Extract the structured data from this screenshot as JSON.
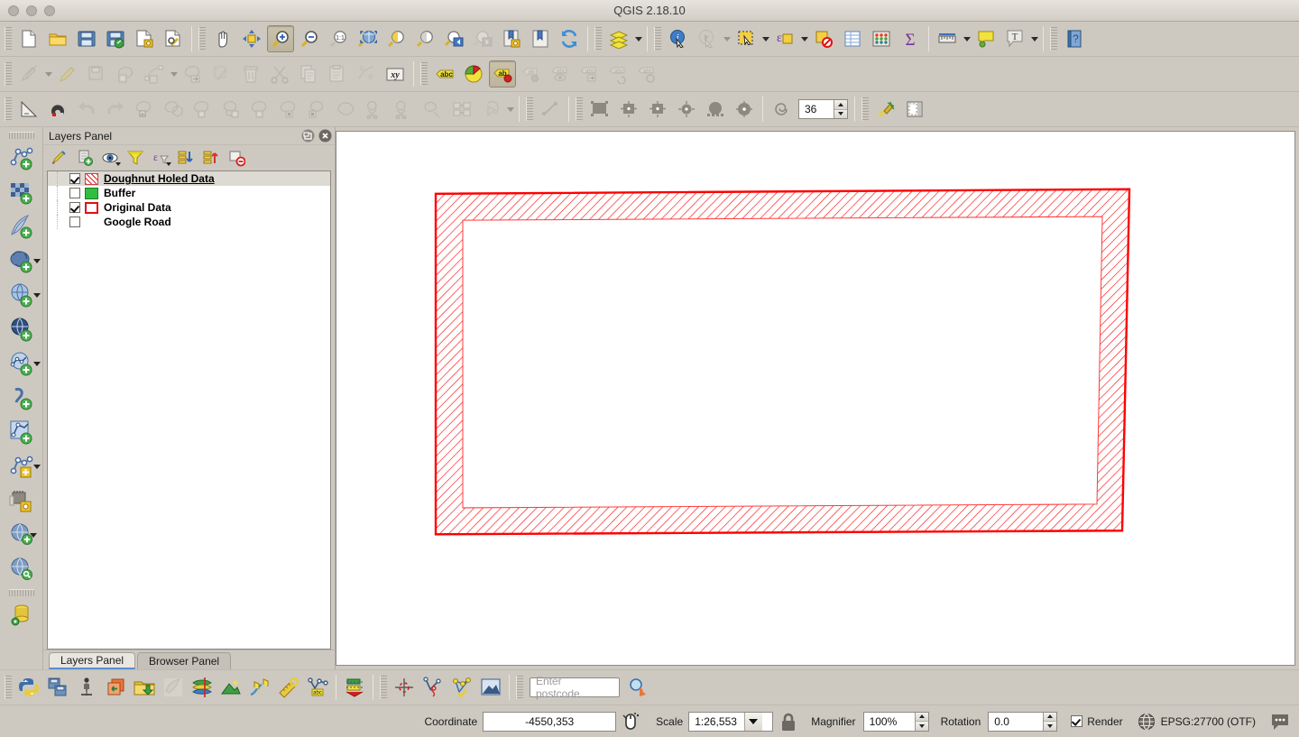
{
  "window": {
    "title": "QGIS 2.18.10",
    "traffic_buttons": [
      "close",
      "minimize",
      "zoom"
    ]
  },
  "toolbars": {
    "row1": [
      {
        "name": "new-project-button",
        "icon": "new-document-icon",
        "label": "New Project"
      },
      {
        "name": "open-project-button",
        "icon": "open-folder-icon",
        "label": "Open Project"
      },
      {
        "name": "save-project-button",
        "icon": "floppy-disk-icon",
        "label": "Save Project"
      },
      {
        "name": "save-project-as-button",
        "icon": "floppy-disk-pencil-icon",
        "label": "Save Project As"
      },
      {
        "name": "new-print-composer-button",
        "icon": "page-gear-icon",
        "label": "New Print Composer"
      },
      {
        "name": "composer-manager-button",
        "icon": "page-wrench-icon",
        "label": "Composer Manager"
      },
      {
        "name": "pan-map-button",
        "icon": "hand-icon",
        "label": "Pan Map"
      },
      {
        "name": "pan-to-selection-button",
        "icon": "arrows-move-icon",
        "label": "Pan Map to Selection"
      },
      {
        "name": "zoom-in-button",
        "icon": "magnifier-plus-icon",
        "label": "Zoom In",
        "active": true
      },
      {
        "name": "zoom-out-button",
        "icon": "magnifier-minus-icon",
        "label": "Zoom Out"
      },
      {
        "name": "zoom-native-button",
        "icon": "magnifier-1to1-icon",
        "label": "Zoom to Native Resolution"
      },
      {
        "name": "zoom-full-button",
        "icon": "zoom-full-extent-icon",
        "label": "Zoom Full"
      },
      {
        "name": "zoom-to-selection-button",
        "icon": "zoom-selection-icon",
        "label": "Zoom to Selection"
      },
      {
        "name": "zoom-to-layer-button",
        "icon": "zoom-layer-icon",
        "label": "Zoom to Layer"
      },
      {
        "name": "zoom-last-button",
        "icon": "zoom-last-icon",
        "label": "Zoom Last"
      },
      {
        "name": "zoom-next-button",
        "icon": "zoom-next-icon",
        "label": "Zoom Next",
        "disabled": true
      },
      {
        "name": "new-map-view-button",
        "icon": "bookmark-gear-icon",
        "label": "New Map View"
      },
      {
        "name": "show-bookmarks-button",
        "icon": "bookmark-icon",
        "label": "Show Bookmarks"
      },
      {
        "name": "refresh-button",
        "icon": "refresh-icon",
        "label": "Refresh"
      },
      {
        "name": "manage-layers-button",
        "icon": "layers-stack-icon",
        "label": "Manage Layers"
      },
      {
        "name": "identify-features-button",
        "icon": "identify-info-icon",
        "label": "Identify Features"
      },
      {
        "name": "run-feature-action-button",
        "icon": "gear-cursor-icon",
        "label": "Run Feature Action",
        "disabled": true
      },
      {
        "name": "select-features-button",
        "icon": "select-rectangle-icon",
        "label": "Select Features"
      },
      {
        "name": "select-by-expression-button",
        "icon": "select-expression-icon",
        "label": "Select by Expression"
      },
      {
        "name": "deselect-features-button",
        "icon": "deselect-icon",
        "label": "Deselect Features"
      },
      {
        "name": "open-attribute-table-button",
        "icon": "table-icon",
        "label": "Open Attribute Table"
      },
      {
        "name": "field-calculator-button",
        "icon": "abacus-icon",
        "label": "Field Calculator"
      },
      {
        "name": "statistical-summary-button",
        "icon": "sigma-icon",
        "label": "Statistical Summary"
      },
      {
        "name": "measure-line-button",
        "icon": "ruler-icon",
        "label": "Measure Line"
      },
      {
        "name": "map-tips-button",
        "icon": "speech-bubble-icon",
        "label": "Show Map Tips"
      },
      {
        "name": "new-text-annotation-button",
        "icon": "text-annotation-icon",
        "label": "Text Annotation"
      },
      {
        "name": "help-button",
        "icon": "help-book-icon",
        "label": "Help"
      }
    ],
    "row2": [
      {
        "name": "current-edits-button",
        "icon": "pencils-icon",
        "label": "Current Edits",
        "disabled": true
      },
      {
        "name": "toggle-editing-button",
        "icon": "pencil-icon",
        "label": "Toggle Editing",
        "disabled": true
      },
      {
        "name": "save-layer-edits-button",
        "icon": "save-edits-icon",
        "label": "Save Layer Edits",
        "disabled": true
      },
      {
        "name": "add-feature-button",
        "icon": "add-polygon-icon",
        "label": "Add Feature",
        "disabled": true
      },
      {
        "name": "add-line-feature-button",
        "icon": "add-line-icon",
        "label": "Add Line Feature",
        "disabled": true
      },
      {
        "name": "move-feature-button",
        "icon": "move-feature-icon",
        "label": "Move Feature",
        "disabled": true
      },
      {
        "name": "node-tool-button",
        "icon": "node-tool-icon",
        "label": "Node Tool",
        "disabled": true
      },
      {
        "name": "delete-selected-button",
        "icon": "trash-icon",
        "label": "Delete Selected",
        "disabled": true
      },
      {
        "name": "cut-features-button",
        "icon": "scissors-icon",
        "label": "Cut Features",
        "disabled": true
      },
      {
        "name": "copy-features-button",
        "icon": "copy-icon",
        "label": "Copy Features",
        "disabled": true
      },
      {
        "name": "paste-features-button",
        "icon": "paste-icon",
        "label": "Paste Features",
        "disabled": true
      },
      {
        "name": "offset-curve-button",
        "icon": "offset-curve-icon",
        "label": "Offset Curve",
        "disabled": true
      },
      {
        "name": "xy-tool-button",
        "icon": "xy-icon",
        "label": "XY Tool"
      },
      {
        "name": "layer-labeling-button",
        "icon": "abc-label-icon",
        "label": "Layer Labeling Options"
      },
      {
        "name": "layer-diagram-button",
        "icon": "pie-diagram-icon",
        "label": "Layer Diagram Options"
      },
      {
        "name": "highlight-pinned-labels-button",
        "icon": "abc-pin-icon",
        "label": "Highlight Pinned Labels",
        "active": true
      },
      {
        "name": "pin-labels-button",
        "icon": "ab-pin-icon",
        "label": "Pin/Unpin Labels",
        "disabled": true
      },
      {
        "name": "show-hide-labels-button",
        "icon": "abc-eye-icon",
        "label": "Show/Hide Labels",
        "disabled": true
      },
      {
        "name": "move-label-button",
        "icon": "abc-move-icon",
        "label": "Move Label",
        "disabled": true
      },
      {
        "name": "rotate-label-button",
        "icon": "abc-rotate-icon",
        "label": "Rotate Label",
        "disabled": true
      },
      {
        "name": "change-label-button",
        "icon": "abc-change-icon",
        "label": "Change Label",
        "disabled": true
      }
    ],
    "row3": [
      {
        "name": "enable-tracing-button",
        "icon": "triangle-ruler-icon",
        "label": "Enable Tracing"
      },
      {
        "name": "enable-snapping-button",
        "icon": "magnet-icon",
        "label": "Enable Snapping"
      },
      {
        "name": "undo-button",
        "icon": "undo-arrow-icon",
        "label": "Undo",
        "disabled": true
      },
      {
        "name": "redo-button",
        "icon": "redo-arrow-icon",
        "label": "Redo",
        "disabled": true
      },
      {
        "name": "rotate-feature-button",
        "icon": "rotate-feature-icon",
        "label": "Rotate Feature",
        "disabled": true
      },
      {
        "name": "simplify-feature-button",
        "icon": "simplify-feature-icon",
        "label": "Simplify Feature",
        "disabled": true
      },
      {
        "name": "add-ring-button",
        "icon": "add-ring-icon",
        "label": "Add Ring",
        "disabled": true
      },
      {
        "name": "add-part-button",
        "icon": "add-part-icon",
        "label": "Add Part",
        "disabled": true
      },
      {
        "name": "fill-ring-button",
        "icon": "fill-ring-icon",
        "label": "Fill Ring",
        "disabled": true
      },
      {
        "name": "delete-ring-button",
        "icon": "delete-ring-icon",
        "label": "Delete Ring",
        "disabled": true
      },
      {
        "name": "delete-part-button",
        "icon": "delete-part-icon",
        "label": "Delete Part",
        "disabled": true
      },
      {
        "name": "reshape-features-button",
        "icon": "reshape-icon",
        "label": "Reshape Features",
        "disabled": true
      },
      {
        "name": "split-features-button",
        "icon": "split-features-icon",
        "label": "Split Features",
        "disabled": true
      },
      {
        "name": "split-parts-button",
        "icon": "split-parts-icon",
        "label": "Split Parts",
        "disabled": true
      },
      {
        "name": "merge-features-button",
        "icon": "merge-features-icon",
        "label": "Merge Features",
        "disabled": true
      },
      {
        "name": "merge-attributes-button",
        "icon": "merge-attributes-icon",
        "label": "Merge Attributes",
        "disabled": true
      },
      {
        "name": "rotate-point-symbols-button",
        "icon": "rotate-point-symbol-icon",
        "label": "Rotate Point Symbols",
        "disabled": true
      },
      {
        "name": "shape-curve-button",
        "icon": "curve-icon",
        "label": "Shape Curve"
      },
      {
        "name": "shape-rectangle-button",
        "icon": "shape-rectangle-icon",
        "label": "Rectangle"
      },
      {
        "name": "shape-rectangle-center-button",
        "icon": "shape-rectangle-center-icon",
        "label": "Rectangle from Center"
      },
      {
        "name": "shape-rectangle-3points-button",
        "icon": "shape-rectangle-3pt-icon",
        "label": "Rectangle 3 Points"
      },
      {
        "name": "shape-circle-2points-button",
        "icon": "shape-circle-2pt-icon",
        "label": "Circle 2 Points"
      },
      {
        "name": "shape-circle-center-button",
        "icon": "shape-circle-center-icon",
        "label": "Circle from Center"
      },
      {
        "name": "shape-ellipse-button",
        "icon": "shape-ellipse-icon",
        "label": "Ellipse"
      },
      {
        "name": "shape-regular-polygon-button",
        "icon": "spiral-icon",
        "label": "Regular Polygon"
      },
      {
        "name": "segments-button",
        "icon": "segments-field",
        "label": "Segments"
      },
      {
        "name": "digitize-with-segment-button",
        "icon": "digitize-pen-icon",
        "label": "Digitizing Tool"
      },
      {
        "name": "vertex-editor-button",
        "icon": "vertex-editor-icon",
        "label": "Vertex Editor"
      }
    ],
    "segments_value": "36"
  },
  "leftbar": {
    "items": [
      {
        "name": "add-vector-layer-button",
        "icon": "add-vector-layer-icon",
        "label": "Add Vector Layer"
      },
      {
        "name": "add-raster-layer-button",
        "icon": "add-raster-layer-icon",
        "label": "Add Raster Layer"
      },
      {
        "name": "add-spatialite-layer-button",
        "icon": "add-spatialite-layer-icon",
        "label": "Add SpatiaLite Layer"
      },
      {
        "name": "add-postgis-layer-button",
        "icon": "add-postgis-layer-icon",
        "label": "Add PostGIS Layer",
        "caret": true
      },
      {
        "name": "add-wms-layer-button",
        "icon": "add-wms-layer-icon",
        "label": "Add WMS/WMTS Layer",
        "caret": true
      },
      {
        "name": "add-wfs-layer-button",
        "icon": "add-wfs-layer-icon",
        "label": "Add WFS Layer"
      },
      {
        "name": "add-delimited-text-layer-button",
        "icon": "add-delimited-text-icon",
        "label": "Add Delimited Text Layer",
        "caret": true
      },
      {
        "name": "add-virtual-layer-button",
        "icon": "add-virtual-layer-icon",
        "label": "Add Virtual Layer"
      },
      {
        "name": "new-shapefile-layer-button",
        "icon": "new-shapefile-icon",
        "label": "New Shapefile Layer"
      },
      {
        "name": "new-geopackage-layer-button",
        "icon": "new-geopackage-icon",
        "label": "New GeoPackage Layer",
        "caret": true
      },
      {
        "name": "new-memory-layer-button",
        "icon": "new-memory-layer-icon",
        "label": "New Memory Layer"
      },
      {
        "name": "add-layer-group-button",
        "icon": "add-layer-group-icon",
        "label": "Add Group",
        "caret": true
      },
      {
        "name": "search-layer-button",
        "icon": "search-globe-icon",
        "label": "Search Layer"
      },
      {
        "name": "db-manager-button",
        "icon": "database-icon",
        "label": "DB Manager"
      }
    ]
  },
  "layers_panel": {
    "title": "Layers Panel",
    "window_buttons": [
      {
        "name": "undock-panel-button",
        "icon": "undock-icon"
      },
      {
        "name": "close-panel-button",
        "icon": "close-icon"
      }
    ],
    "toolbar": [
      {
        "name": "layer-styling-button",
        "icon": "paint-brush-icon",
        "label": "Open Layer Styling Panel"
      },
      {
        "name": "add-group-button",
        "icon": "add-group-icon",
        "label": "Add Group"
      },
      {
        "name": "manage-visibility-button",
        "icon": "eye-icon",
        "label": "Manage Map Themes",
        "caret": true
      },
      {
        "name": "filter-legend-button",
        "icon": "funnel-icon",
        "label": "Filter Legend"
      },
      {
        "name": "expression-filter-button",
        "icon": "epsilon-filter-icon",
        "label": "Filter Legend by Expression",
        "caret": true
      },
      {
        "name": "expand-all-button",
        "icon": "expand-all-icon",
        "label": "Expand All"
      },
      {
        "name": "collapse-all-button",
        "icon": "collapse-all-icon",
        "label": "Collapse All"
      },
      {
        "name": "remove-layer-button",
        "icon": "remove-layer-icon",
        "label": "Remove Layer/Group"
      }
    ],
    "layers": [
      {
        "name": "Doughnut Holed Data",
        "checked": true,
        "selected": true,
        "swatch": "hatch-red",
        "swatch_color": "#e02020"
      },
      {
        "name": "Buffer",
        "checked": false,
        "selected": false,
        "swatch": "solid",
        "swatch_color": "#2fbf3f"
      },
      {
        "name": "Original Data",
        "checked": true,
        "selected": false,
        "swatch": "outline",
        "swatch_color": "#e01010"
      },
      {
        "name": "Google Road",
        "checked": false,
        "selected": false,
        "swatch": "none",
        "swatch_color": ""
      }
    ],
    "tabs": [
      {
        "name": "tab-layers-panel",
        "label": "Layers Panel",
        "active": true
      },
      {
        "name": "tab-browser-panel",
        "label": "Browser Panel",
        "active": false
      }
    ]
  },
  "canvas": {
    "feature_name": "doughnut-polygon",
    "outline_color": "#ff0000",
    "hatch_color": "#ff1414",
    "background": "#ffffff"
  },
  "plugin_bar": {
    "items": [
      {
        "name": "python-console-button",
        "icon": "python-icon",
        "label": "Python Console"
      },
      {
        "name": "plugin-manager-button",
        "icon": "plugin-manager-icon",
        "label": "Plugin Manager"
      },
      {
        "name": "osm-download-button",
        "icon": "osm-icon",
        "label": "OSM Tool"
      },
      {
        "name": "mmqgis-button",
        "icon": "mmqgis-icon",
        "label": "MMQGIS"
      },
      {
        "name": "open-layers-button",
        "icon": "open-layers-icon",
        "label": "OpenLayers Plugin"
      },
      {
        "name": "shape-tools-button",
        "icon": "shape-tools-icon",
        "label": "Shape Tools",
        "disabled": true
      },
      {
        "name": "group-stats-button",
        "icon": "group-stats-icon",
        "label": "Group Stats"
      },
      {
        "name": "contour-button",
        "icon": "contour-icon",
        "label": "Contour"
      },
      {
        "name": "profile-tool-button",
        "icon": "profile-tool-icon",
        "label": "Profile Tool"
      },
      {
        "name": "measure-tool-button",
        "icon": "yellow-ruler-icon",
        "label": "Measure Tool"
      },
      {
        "name": "label-network-button",
        "icon": "network-label-icon",
        "label": "Network Label"
      },
      {
        "name": "topology-checker-button",
        "icon": "topology-checker-icon",
        "label": "Topology Checker"
      },
      {
        "name": "coordinate-capture-button",
        "icon": "coordinate-capture-icon",
        "label": "Coordinate Capture"
      },
      {
        "name": "geometry-checker-button",
        "icon": "geometry-checker-icon",
        "label": "Geometry Checker"
      },
      {
        "name": "network-analysis-button",
        "icon": "network-analysis-icon",
        "label": "Network Analysis"
      },
      {
        "name": "georeferencer-button",
        "icon": "georeferencer-icon",
        "label": "Georeferencer"
      }
    ],
    "postcode_placeholder": "Enter postcode...",
    "postcode_value": "",
    "postcode_search_button": {
      "name": "postcode-search-button",
      "icon": "search-magnifier-icon"
    }
  },
  "status_bar": {
    "coordinate_label": "Coordinate",
    "coordinate_value": "-4550,353",
    "toggle_extents_button": {
      "name": "toggle-extents-button",
      "icon": "mouse-extents-icon"
    },
    "scale_label": "Scale",
    "scale_value": "1:26,553",
    "scale_lock_button": {
      "name": "scale-lock-button",
      "icon": "padlock-icon"
    },
    "magnifier_label": "Magnifier",
    "magnifier_value": "100%",
    "rotation_label": "Rotation",
    "rotation_value": "0.0",
    "render_label": "Render",
    "render_checked": true,
    "crs_label": "EPSG:27700 (OTF)",
    "crs_icon": "globe-crs-icon",
    "messages_button": {
      "name": "messages-button",
      "icon": "speech-dots-icon"
    }
  }
}
